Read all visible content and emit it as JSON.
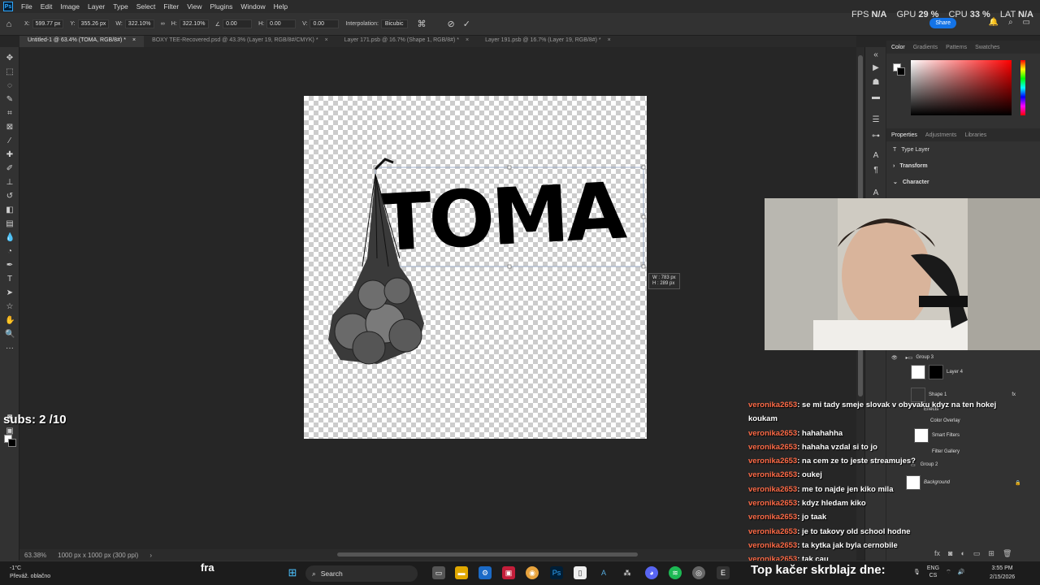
{
  "app": {
    "name": "Ps",
    "menu": [
      "File",
      "Edit",
      "Image",
      "Layer",
      "Type",
      "Select",
      "Filter",
      "View",
      "Plugins",
      "Window",
      "Help"
    ]
  },
  "perf": {
    "fps_label": "FPS",
    "fps_value": "N/A",
    "gpu_label": "GPU",
    "gpu_value": "29 %",
    "cpu_label": "CPU",
    "cpu_value": "33 %",
    "lat_label": "LAT",
    "lat_value": "N/A"
  },
  "options": {
    "x_label": "X:",
    "x_value": "599.77 px",
    "y_label": "Y:",
    "y_value": "355.26 px",
    "w_label": "W:",
    "w_value": "322.10%",
    "h_label": "H:",
    "h_value": "322.10%",
    "angle_value": "0.00",
    "hskew_label": "H:",
    "hskew_value": "0.00",
    "vskew_label": "V:",
    "vskew_value": "0.00",
    "interp_label": "Interpolation:",
    "interp_value": "Bicubic",
    "share_label": "Share"
  },
  "tabs": [
    "Untitled-1 @ 63.4% (TOMA, RGB/8#) *",
    "BOXY TEE-Recovered.psd @ 43.3% (Layer 19, RGB/8#/CMYK) *",
    "Layer 171.psb @ 16.7% (Shape 1, RGB/8#) *",
    "Layer 191.psb @ 16.7% (Layer 19, RGB/8#) *"
  ],
  "canvas": {
    "artwork_text": "TOMA",
    "readout_w": "W : 783 px",
    "readout_h": "H : 289 px",
    "subs": "subs: 2 /10"
  },
  "status": {
    "zoom": "63.38%",
    "doc_info": "1000 px x 1000 px (300 ppi)"
  },
  "panels": {
    "color_tabs": [
      "Color",
      "Gradients",
      "Patterns",
      "Swatches"
    ],
    "props_tabs": [
      "Properties",
      "Adjustments",
      "Libraries"
    ],
    "type_layer": "Type Layer",
    "transform": "Transform",
    "character": "Character"
  },
  "layers": [
    {
      "name": "Group 3"
    },
    {
      "name": "Layer 4"
    },
    {
      "name": "Shape 1"
    },
    {
      "name": "Effects"
    },
    {
      "name": "Color Overlay"
    },
    {
      "name": "Smart Filters"
    },
    {
      "name": "Filter Gallery"
    },
    {
      "name": "Group 2"
    },
    {
      "name": "Background"
    }
  ],
  "chat": [
    {
      "user": "veronika2653",
      "text": "se mi tady smeje slovak v obyvaku kdyz na ten hokej koukam"
    },
    {
      "user": "veronika2653",
      "text": "hahahahha"
    },
    {
      "user": "veronika2653",
      "text": "hahaha vzdal si to jo"
    },
    {
      "user": "veronika2653",
      "text": "na cem ze to jeste streamujes?"
    },
    {
      "user": "veronika2653",
      "text": "oukej"
    },
    {
      "user": "veronika2653",
      "text": "me to najde jen kiko mila"
    },
    {
      "user": "veronika2653",
      "text": "kdyz hledam kiko"
    },
    {
      "user": "veronika2653",
      "text": "jo taak"
    },
    {
      "user": "veronika2653",
      "text": "je to takovy old school hodne"
    },
    {
      "user": "veronika2653",
      "text": "ta kytka jak byla cernobile"
    },
    {
      "user": "veronika2653",
      "text": "tak cau"
    }
  ],
  "taskbar": {
    "temp": "-1°C",
    "weather": "Převáž. oblačno",
    "fra": "fra",
    "search": "Search",
    "ticker": "Top kačer skrblajz dne:",
    "lang": "ENG",
    "lang_sub": "CS",
    "time": "3:55 PM",
    "date": "2/15/2026"
  }
}
